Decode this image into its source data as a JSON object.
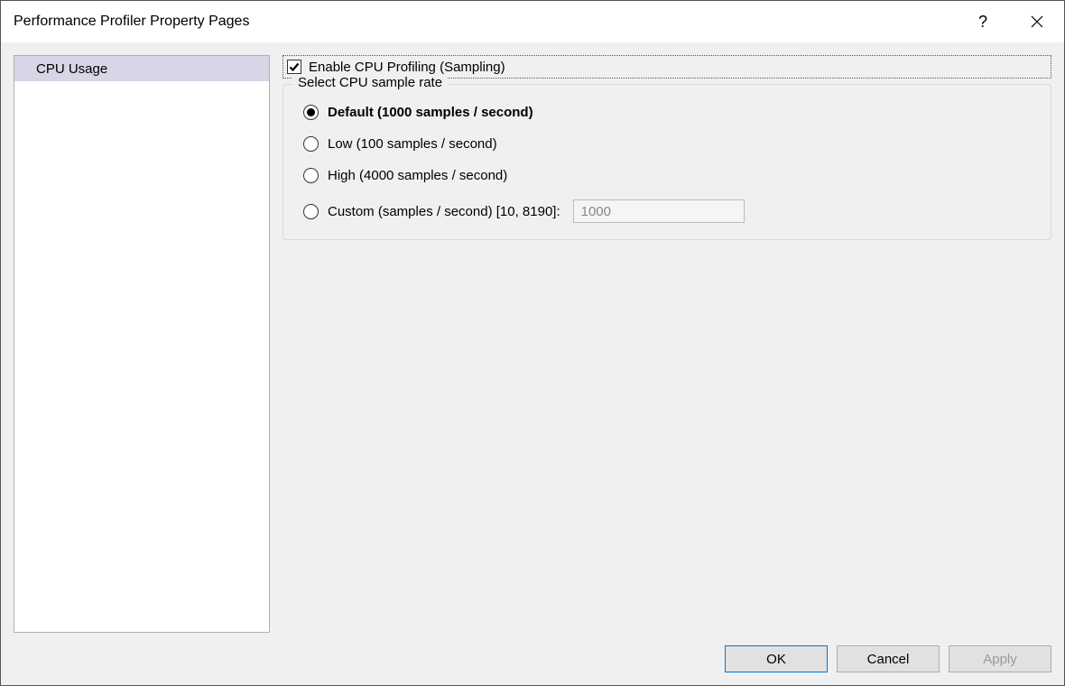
{
  "titlebar": {
    "title": "Performance Profiler Property Pages",
    "help_symbol": "?",
    "close_label": "Close"
  },
  "nav": {
    "items": [
      {
        "label": "CPU Usage",
        "selected": true
      }
    ]
  },
  "panel": {
    "enable_checkbox": {
      "label": "Enable CPU Profiling (Sampling)",
      "checked": true
    },
    "fieldset": {
      "legend": "Select CPU sample rate",
      "options": [
        {
          "id": "default",
          "label": "Default (1000 samples / second)",
          "selected": true
        },
        {
          "id": "low",
          "label": "Low (100 samples / second)",
          "selected": false
        },
        {
          "id": "high",
          "label": "High (4000 samples / second)",
          "selected": false
        },
        {
          "id": "custom",
          "label": "Custom (samples / second) [10, 8190]:",
          "selected": false
        }
      ],
      "custom_value": "1000"
    }
  },
  "buttons": {
    "ok": "OK",
    "cancel": "Cancel",
    "apply": "Apply"
  }
}
